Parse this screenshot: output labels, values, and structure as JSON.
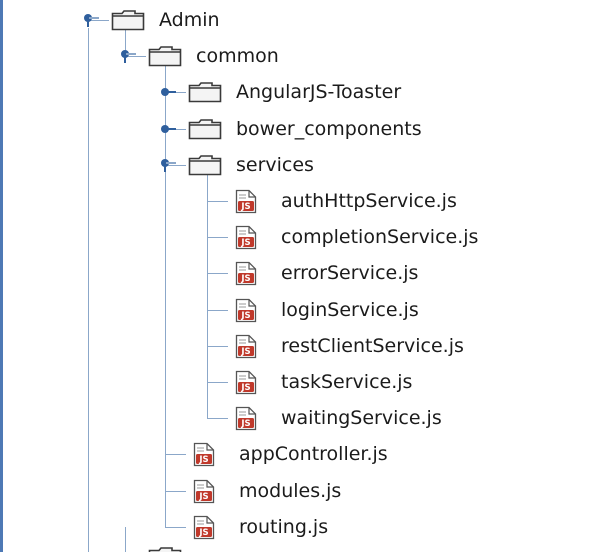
{
  "tree": {
    "nodes": [
      {
        "label": "Admin",
        "type": "folder",
        "level": 0,
        "expanded": true,
        "icon": "folder-icon"
      },
      {
        "label": "common",
        "type": "folder",
        "level": 1,
        "expanded": true,
        "icon": "folder-icon"
      },
      {
        "label": "AngularJS-Toaster",
        "type": "folder",
        "level": 2,
        "expanded": false,
        "icon": "folder-icon"
      },
      {
        "label": "bower_components",
        "type": "folder",
        "level": 2,
        "expanded": false,
        "icon": "folder-icon"
      },
      {
        "label": "services",
        "type": "folder",
        "level": 2,
        "expanded": true,
        "icon": "folder-icon"
      },
      {
        "label": "authHttpService.js",
        "type": "file",
        "level": 3,
        "icon": "js-file-icon"
      },
      {
        "label": "completionService.js",
        "type": "file",
        "level": 3,
        "icon": "js-file-icon"
      },
      {
        "label": "errorService.js",
        "type": "file",
        "level": 3,
        "icon": "js-file-icon"
      },
      {
        "label": "loginService.js",
        "type": "file",
        "level": 3,
        "icon": "js-file-icon"
      },
      {
        "label": "restClientService.js",
        "type": "file",
        "level": 3,
        "icon": "js-file-icon"
      },
      {
        "label": "taskService.js",
        "type": "file",
        "level": 3,
        "icon": "js-file-icon"
      },
      {
        "label": "waitingService.js",
        "type": "file",
        "level": 3,
        "icon": "js-file-icon"
      },
      {
        "label": "appController.js",
        "type": "file",
        "level": 2,
        "icon": "js-file-icon"
      },
      {
        "label": "modules.js",
        "type": "file",
        "level": 2,
        "icon": "js-file-icon"
      },
      {
        "label": "routing.js",
        "type": "file",
        "level": 2,
        "icon": "js-file-icon"
      }
    ],
    "file_badge_text": "JS"
  },
  "colors": {
    "frame_border": "#4e79b5",
    "tree_line": "#8ba7c9",
    "handle": "#2f5f9d",
    "folder_stroke": "#3a3a3a",
    "folder_fill": "#f4f4f4",
    "js_badge": "#c0392b"
  }
}
